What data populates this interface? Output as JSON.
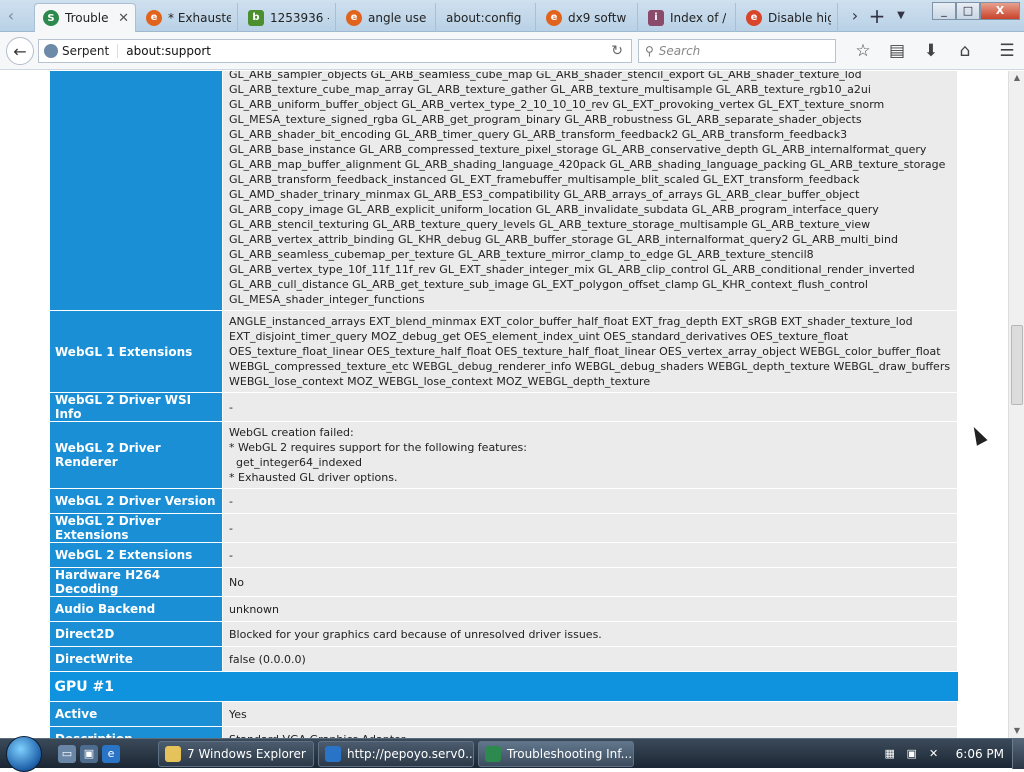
{
  "tabs": [
    {
      "title": "Trouble",
      "active": true,
      "icon": "serpent-icon"
    },
    {
      "title": "* Exhauste",
      "active": false,
      "icon": "globe-icon"
    },
    {
      "title": "1253936 -",
      "active": false,
      "icon": "bug-icon"
    },
    {
      "title": "angle use",
      "active": false,
      "icon": "globe-icon"
    },
    {
      "title": "about:config",
      "active": false,
      "icon": "none"
    },
    {
      "title": "dx9 softw",
      "active": false,
      "icon": "globe-icon"
    },
    {
      "title": "Index of /",
      "active": false,
      "icon": "folder-icon"
    },
    {
      "title": "Disable hig",
      "active": false,
      "icon": "globe-icon"
    }
  ],
  "window_controls": {
    "minimize": "_",
    "maximize": "□",
    "close": "X"
  },
  "navbar": {
    "identity": "Serpent",
    "url": "about:support",
    "search_placeholder": "Search"
  },
  "rows": [
    {
      "key": "",
      "value": "GL_ARB_sampler_objects GL_ARB_seamless_cube_map GL_ARB_shader_stencil_export GL_ARB_shader_texture_lod GL_ARB_texture_cube_map_array GL_ARB_texture_gather GL_ARB_texture_multisample GL_ARB_texture_rgb10_a2ui GL_ARB_uniform_buffer_object GL_ARB_vertex_type_2_10_10_10_rev GL_EXT_provoking_vertex GL_EXT_texture_snorm GL_MESA_texture_signed_rgba GL_ARB_get_program_binary GL_ARB_robustness GL_ARB_separate_shader_objects GL_ARB_shader_bit_encoding GL_ARB_timer_query GL_ARB_transform_feedback2 GL_ARB_transform_feedback3 GL_ARB_base_instance GL_ARB_compressed_texture_pixel_storage GL_ARB_conservative_depth GL_ARB_internalformat_query GL_ARB_map_buffer_alignment GL_ARB_shading_language_420pack GL_ARB_shading_language_packing GL_ARB_texture_storage GL_ARB_transform_feedback_instanced GL_EXT_framebuffer_multisample_blit_scaled GL_EXT_transform_feedback GL_AMD_shader_trinary_minmax GL_ARB_ES3_compatibility GL_ARB_arrays_of_arrays GL_ARB_clear_buffer_object GL_ARB_copy_image GL_ARB_explicit_uniform_location GL_ARB_invalidate_subdata GL_ARB_program_interface_query GL_ARB_stencil_texturing GL_ARB_texture_query_levels GL_ARB_texture_storage_multisample GL_ARB_texture_view GL_ARB_vertex_attrib_binding GL_KHR_debug GL_ARB_buffer_storage GL_ARB_internalformat_query2 GL_ARB_multi_bind GL_ARB_seamless_cubemap_per_texture GL_ARB_texture_mirror_clamp_to_edge GL_ARB_texture_stencil8 GL_ARB_vertex_type_10f_11f_11f_rev GL_EXT_shader_integer_mix GL_ARB_clip_control GL_ARB_conditional_render_inverted GL_ARB_cull_distance GL_ARB_get_texture_sub_image GL_EXT_polygon_offset_clamp GL_KHR_context_flush_control GL_MESA_shader_integer_functions"
    },
    {
      "key": "WebGL 1 Extensions",
      "value": "ANGLE_instanced_arrays EXT_blend_minmax EXT_color_buffer_half_float EXT_frag_depth EXT_sRGB EXT_shader_texture_lod EXT_disjoint_timer_query MOZ_debug_get OES_element_index_uint OES_standard_derivatives OES_texture_float OES_texture_float_linear OES_texture_half_float OES_texture_half_float_linear OES_vertex_array_object WEBGL_color_buffer_float WEBGL_compressed_texture_etc WEBGL_debug_renderer_info WEBGL_debug_shaders WEBGL_depth_texture WEBGL_draw_buffers WEBGL_lose_context MOZ_WEBGL_lose_context MOZ_WEBGL_depth_texture"
    },
    {
      "key": "WebGL 2 Driver WSI Info",
      "value": "-"
    },
    {
      "key": "WebGL 2 Driver Renderer",
      "value": "WebGL creation failed:\n* WebGL 2 requires support for the following features:\n  get_integer64_indexed\n* Exhausted GL driver options."
    },
    {
      "key": "WebGL 2 Driver Version",
      "value": "-"
    },
    {
      "key": "WebGL 2 Driver Extensions",
      "value": "-"
    },
    {
      "key": "WebGL 2 Extensions",
      "value": "-"
    },
    {
      "key": "Hardware H264 Decoding",
      "value": "No"
    },
    {
      "key": "Audio Backend",
      "value": "unknown"
    },
    {
      "key": "Direct2D",
      "value": "Blocked for your graphics card because of unresolved driver issues."
    },
    {
      "key": "DirectWrite",
      "value": "false (0.0.0.0)"
    }
  ],
  "gpu_heading": "GPU #1",
  "gpu_rows": [
    {
      "key": "Active",
      "value": "Yes"
    },
    {
      "key": "Description",
      "value": "Standard VGA Graphics Adapter"
    }
  ],
  "taskbar": {
    "items": [
      {
        "label": "7 Windows Explorer",
        "icon": "folder-icon"
      },
      {
        "label": "http://pepoyo.serv0...",
        "icon": "ie-icon"
      },
      {
        "label": "Troubleshooting Inf...",
        "icon": "serpent-icon"
      }
    ],
    "clock": "6:06 PM"
  },
  "colors": {
    "key_bg": "#1a8fd6",
    "value_bg": "#ebebeb",
    "heading_bg": "#0f93de"
  }
}
